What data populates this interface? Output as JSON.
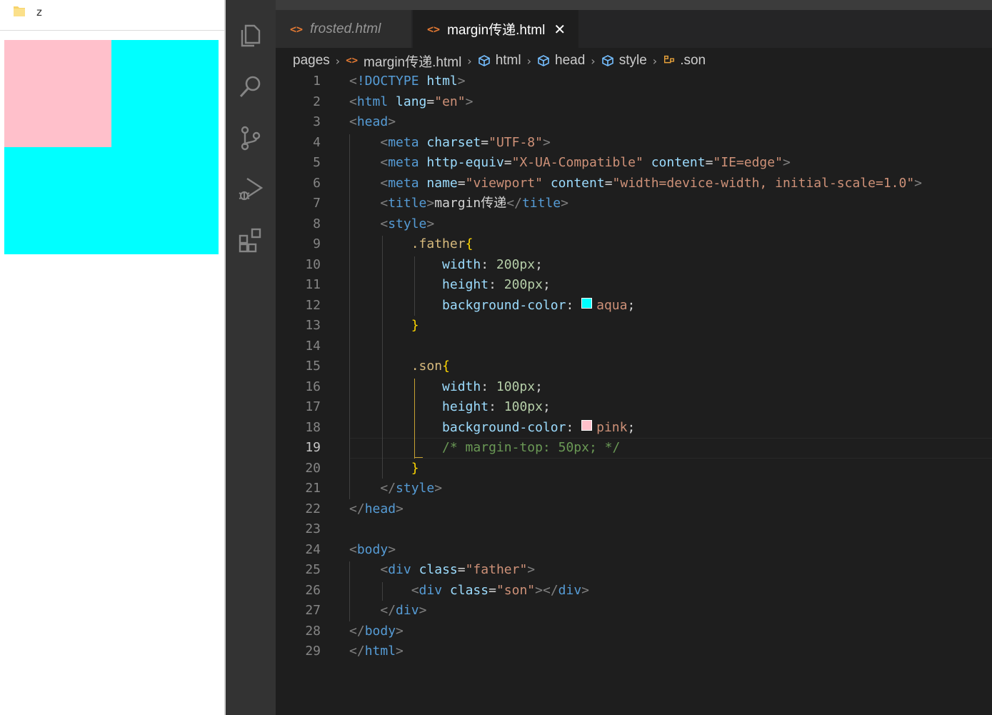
{
  "browser": {
    "tab_label": "z",
    "father_color": "#00ffff",
    "son_color": "#ffc0cb"
  },
  "activity_bar": {
    "icons": [
      "explorer-icon",
      "search-icon",
      "source-control-icon",
      "run-debug-icon",
      "extensions-icon"
    ]
  },
  "tabs": [
    {
      "label": "frosted.html",
      "active": false
    },
    {
      "label": "margin传递.html",
      "active": true
    }
  ],
  "breadcrumb": {
    "items": [
      "pages",
      "margin传递.html",
      "html",
      "head",
      "style",
      ".son"
    ]
  },
  "editor": {
    "current_line": 19,
    "lines": [
      "<!DOCTYPE html>",
      "<html lang=\"en\">",
      "<head>",
      "    <meta charset=\"UTF-8\">",
      "    <meta http-equiv=\"X-UA-Compatible\" content=\"IE=edge\">",
      "    <meta name=\"viewport\" content=\"width=device-width, initial-scale=1.0\">",
      "    <title>margin传递</title>",
      "    <style>",
      "        .father{",
      "            width: 200px;",
      "            height: 200px;",
      "            background-color: aqua;",
      "        }",
      "",
      "        .son{",
      "            width: 100px;",
      "            height: 100px;",
      "            background-color: pink;",
      "            /* margin-top: 50px; */",
      "        }",
      "    </style>",
      "</head>",
      "",
      "<body>",
      "    <div class=\"father\">",
      "        <div class=\"son\"></div>",
      "    </div>",
      "</body>",
      "</html>"
    ]
  }
}
